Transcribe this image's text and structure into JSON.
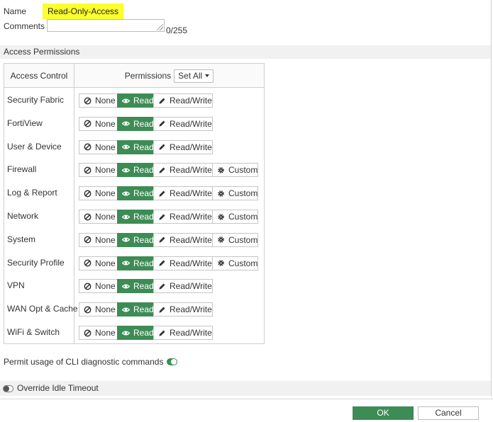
{
  "form": {
    "name_label": "Name",
    "name_value": "Read-Only-Access",
    "comments_label": "Comments",
    "comments_value": "",
    "comments_count": "0/255"
  },
  "access_permissions": {
    "section_title": "Access Permissions",
    "col_access_control": "Access Control",
    "col_permissions": "Permissions",
    "set_all_label": "Set All",
    "option_labels": {
      "none": "None",
      "read": "Read",
      "read_write": "Read/Write",
      "custom": "Custom"
    },
    "rows": [
      {
        "label": "Security Fabric",
        "selected": "Read",
        "has_custom": false
      },
      {
        "label": "FortiView",
        "selected": "Read",
        "has_custom": false
      },
      {
        "label": "User & Device",
        "selected": "Read",
        "has_custom": false
      },
      {
        "label": "Firewall",
        "selected": "Read",
        "has_custom": true
      },
      {
        "label": "Log & Report",
        "selected": "Read",
        "has_custom": true
      },
      {
        "label": "Network",
        "selected": "Read",
        "has_custom": true
      },
      {
        "label": "System",
        "selected": "Read",
        "has_custom": true
      },
      {
        "label": "Security Profile",
        "selected": "Read",
        "has_custom": true
      },
      {
        "label": "VPN",
        "selected": "Read",
        "has_custom": false
      },
      {
        "label": "WAN Opt & Cache",
        "selected": "Read",
        "has_custom": false
      },
      {
        "label": "WiFi & Switch",
        "selected": "Read",
        "has_custom": false
      }
    ]
  },
  "cli_diagnostic": {
    "label": "Permit usage of CLI diagnostic commands",
    "enabled": true
  },
  "idle_timeout": {
    "label": "Override Idle Timeout",
    "enabled": false
  },
  "footer": {
    "ok_label": "OK",
    "cancel_label": "Cancel"
  },
  "colors": {
    "accent_green": "#3d8c55",
    "highlight_yellow": "#fbff2c",
    "section_bg": "#f1f1f1"
  }
}
